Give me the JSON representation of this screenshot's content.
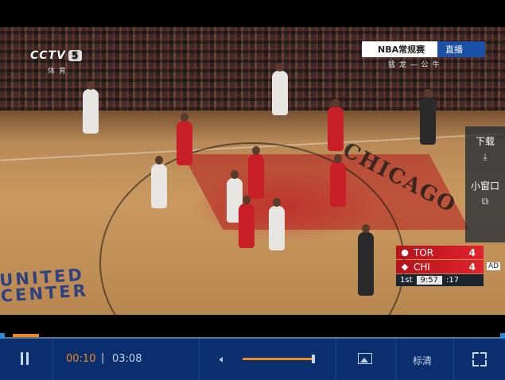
{
  "video": {
    "channel": "CCTV",
    "channel_number": "5",
    "channel_sub": "体 育",
    "program": "NBA常规赛",
    "live_label": "直播",
    "program_sub": "猛 龙 — 公 牛",
    "court_text_chicago": "CHICAGO",
    "court_text_united": "UNITED",
    "court_text_center": "CENTER"
  },
  "scoreboard": {
    "teams": [
      {
        "abbr": "TOR",
        "score": "4",
        "logo_icon": "raptors-logo-icon"
      },
      {
        "abbr": "CHI",
        "score": "4",
        "logo_icon": "bulls-logo-icon"
      }
    ],
    "period": "1st",
    "clock": "9:57",
    "shot_clock": ":17",
    "ad_label": "AD"
  },
  "side_panel": {
    "download_label": "下载",
    "download_icon": "download-icon",
    "mini_window_label": "小窗口",
    "mini_window_icon": "mini-window-icon"
  },
  "player_bar": {
    "progress_fraction": 0.054,
    "current_time": "00:10",
    "divider": "|",
    "total_time": "03:08",
    "volume_fraction": 0.97,
    "quality_label": "标清",
    "accent_color": "#f08a1c",
    "bar_color": "#0a2e6e"
  }
}
